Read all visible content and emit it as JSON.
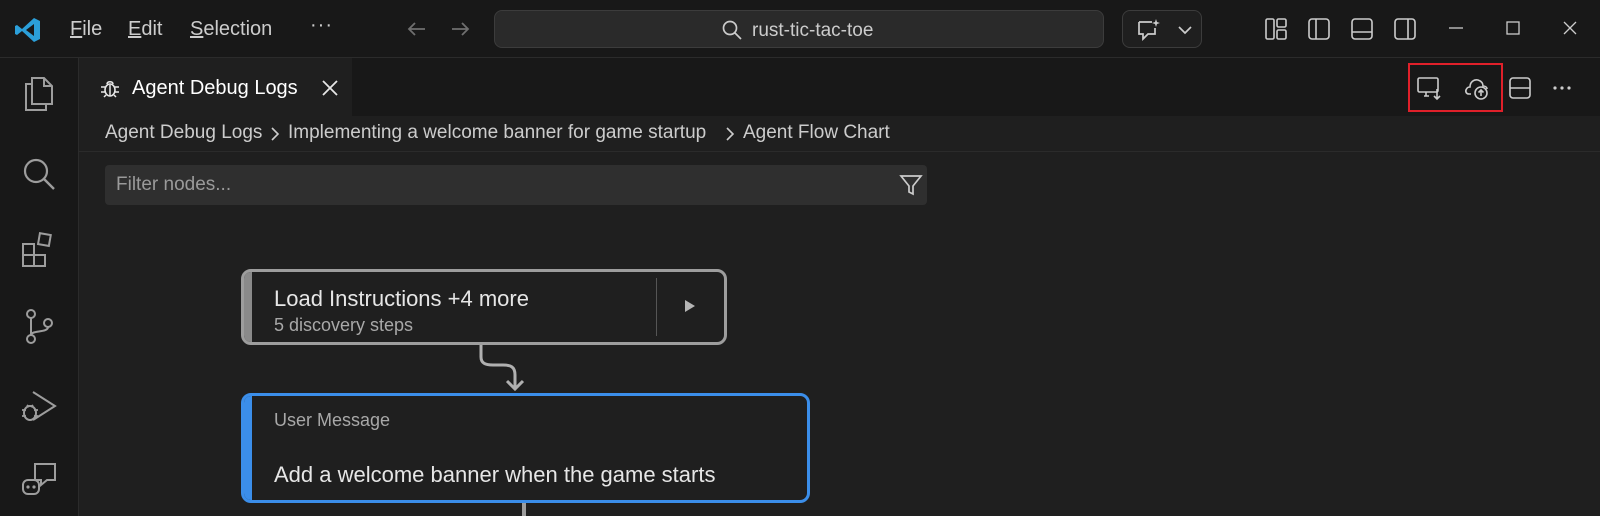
{
  "titlebar": {
    "menu": [
      {
        "prefix": "",
        "underline": "F",
        "rest": "ile"
      },
      {
        "prefix": "",
        "underline": "E",
        "rest": "dit"
      },
      {
        "prefix": "",
        "underline": "S",
        "rest": "election"
      }
    ],
    "more": "···",
    "search_text": "rust-tic-tac-toe"
  },
  "tab": {
    "label": "Agent Debug Logs"
  },
  "breadcrumb": [
    "Agent Debug Logs",
    "Implementing a welcome banner for game startup",
    "Agent Flow Chart"
  ],
  "filter": {
    "placeholder": "Filter nodes..."
  },
  "nodes": [
    {
      "title": "Load Instructions +4 more",
      "subtitle": "5 discovery steps"
    },
    {
      "type": "User Message",
      "message": "Add a welcome banner when the game starts"
    }
  ],
  "colors": {
    "accent": "#3b8eea",
    "highlight": "#e0202a",
    "vscode_logo": "#2b9fd9"
  }
}
